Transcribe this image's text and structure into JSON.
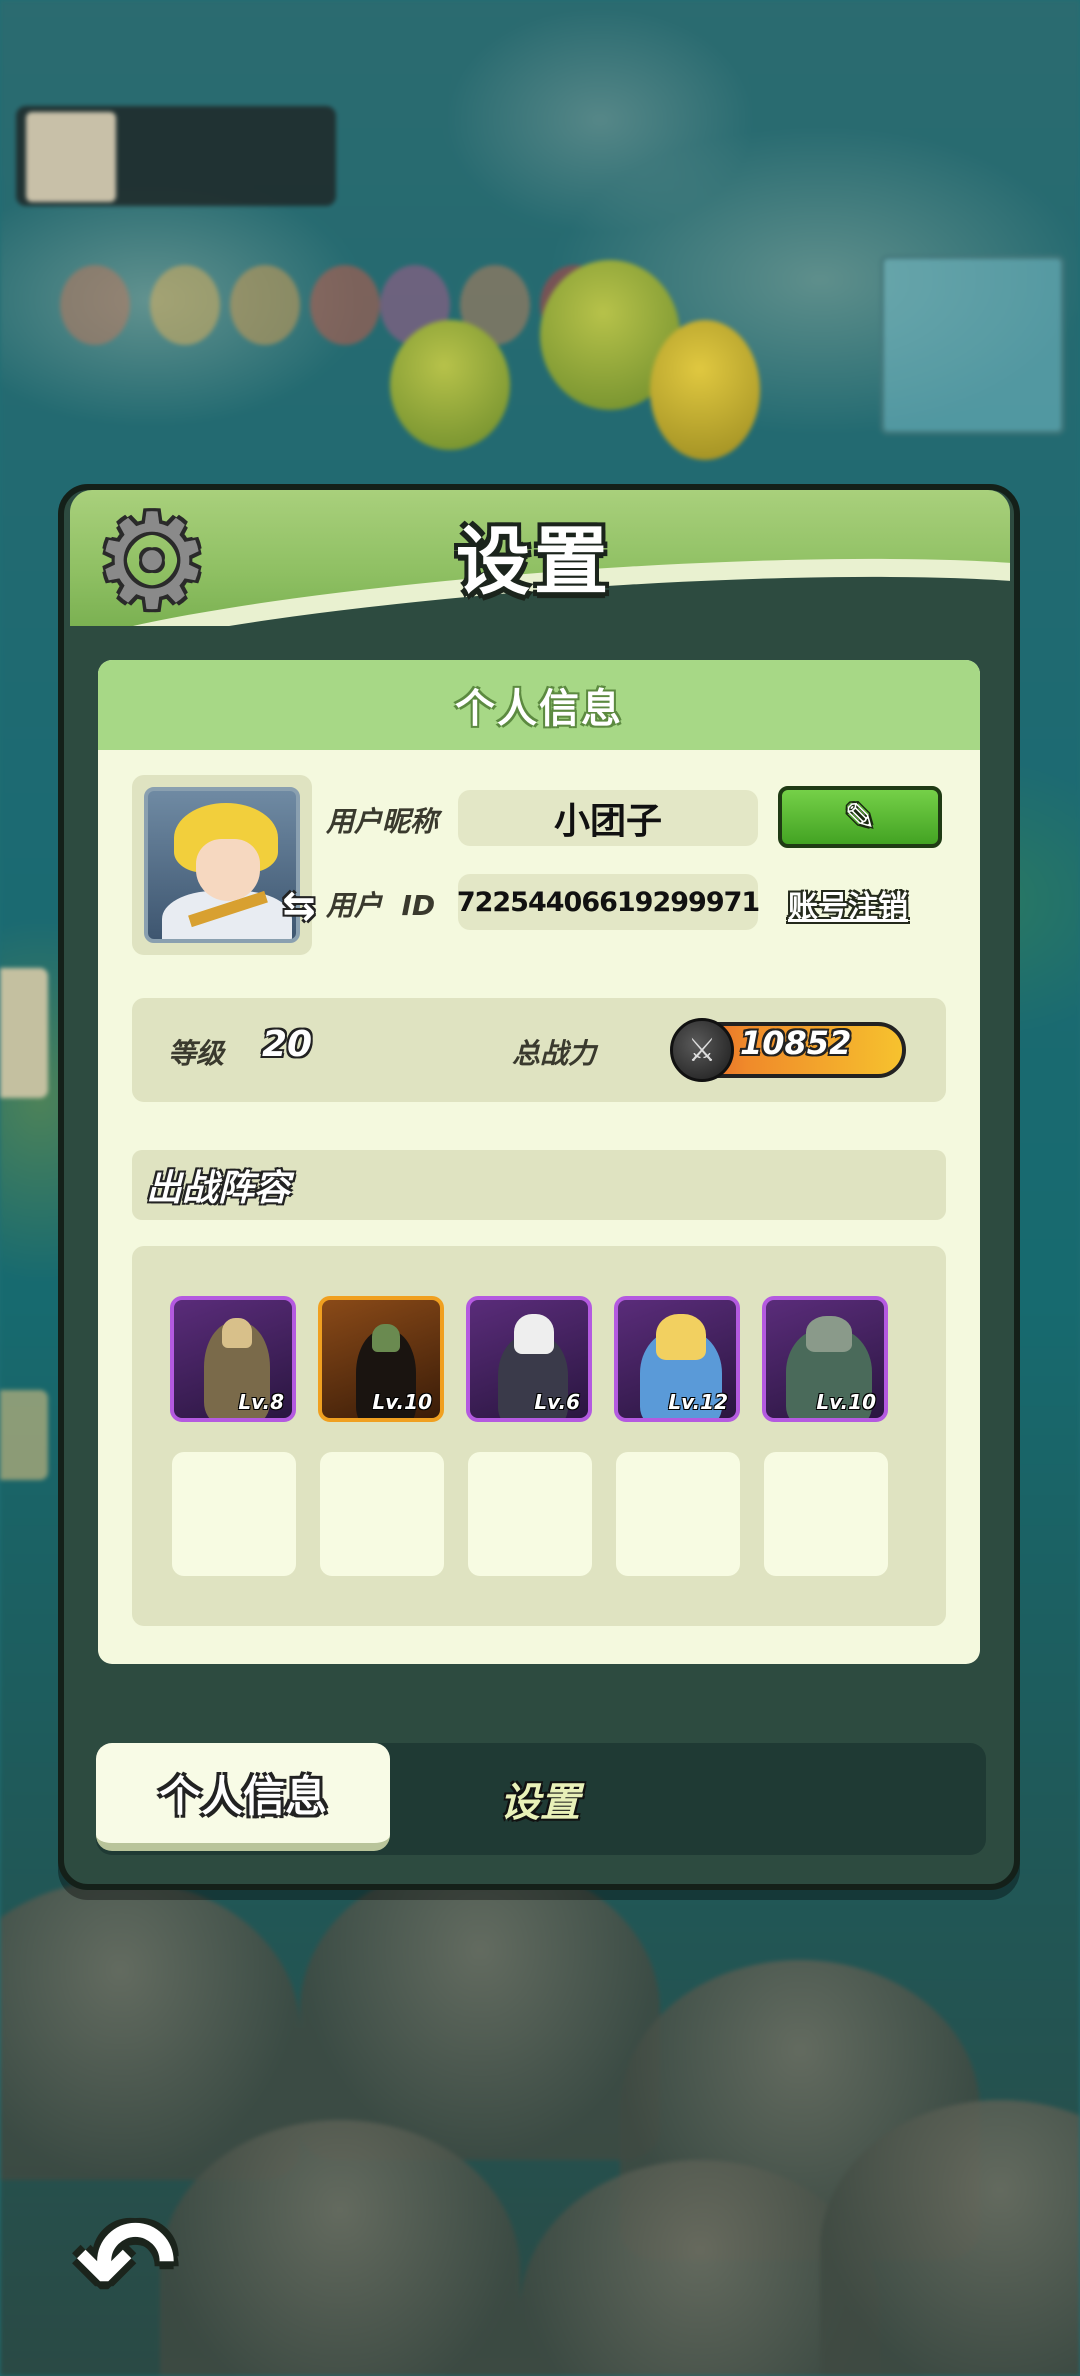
{
  "panel": {
    "title": "设置",
    "gear_icon": "gear-icon"
  },
  "profile": {
    "section_title": "个人信息",
    "nickname_label": "用户昵称",
    "nickname": "小团子",
    "id_label": "用户  ID",
    "user_id": "72254406619299971",
    "cancel_account": "账号注销",
    "edit_icon": "pencil-icon",
    "swap_icon": "swap-arrows-icon"
  },
  "stats": {
    "level_label": "等级",
    "level": "20",
    "power_label": "总战力",
    "power": "10852"
  },
  "lineup": {
    "title": "出战阵容",
    "heroes": [
      {
        "level": "Lv.8",
        "rarity": "purple"
      },
      {
        "level": "Lv.10",
        "rarity": "orange"
      },
      {
        "level": "Lv.6",
        "rarity": "purple"
      },
      {
        "level": "Lv.12",
        "rarity": "purple"
      },
      {
        "level": "Lv.10",
        "rarity": "purple"
      }
    ],
    "empty_slots": 5
  },
  "tabs": {
    "profile": "个人信息",
    "settings": "设置"
  },
  "colors": {
    "accent_green": "#8fc063",
    "panel_dark": "#2d4b40",
    "card_bg": "#f4f9de",
    "rarity_purple": "#b45ae0",
    "rarity_orange": "#f0a020"
  }
}
